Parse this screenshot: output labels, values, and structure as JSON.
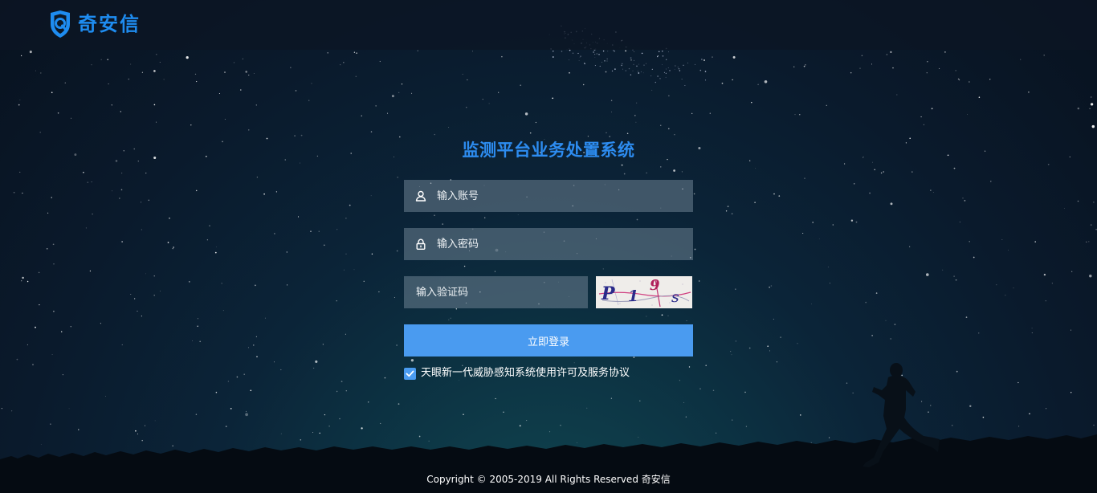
{
  "header": {
    "brand_name": "奇安信",
    "logo_icon": "shield-q-icon",
    "brand_color": "#1e8cf0"
  },
  "login": {
    "title": "监测平台业务处置系统",
    "username": {
      "placeholder": "输入账号",
      "value": "",
      "icon": "user-icon"
    },
    "password": {
      "placeholder": "输入密码",
      "value": "",
      "icon": "lock-icon"
    },
    "captcha": {
      "placeholder": "输入验证码",
      "value": "",
      "image_text": "P19s"
    },
    "submit_label": "立即登录",
    "agreement": {
      "checked": true,
      "label": "天眼新一代威胁感知系统使用许可及服务协议"
    },
    "accent_color": "#4a9bf0"
  },
  "footer": {
    "copyright": "Copyright © 2005-2019 All Rights Reserved 奇安信"
  }
}
